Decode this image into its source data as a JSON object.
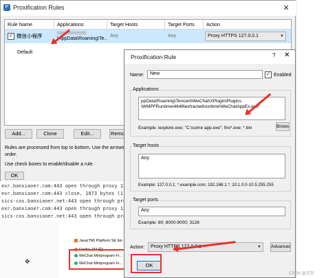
{
  "rules_window": {
    "title": "Proxification Rules",
    "columns": [
      "Rule Name",
      "Applications",
      "Target Hosts",
      "Target Ports",
      "Action"
    ],
    "rows": [
      {
        "name": "微信小程序",
        "app_prefix": "\\AppData\\Roaming\\Te...",
        "hosts": "Any",
        "ports": "Any",
        "action": "Proxy HTTPS 127.0.0.1"
      },
      {
        "name": "Default",
        "app": "",
        "hosts": "",
        "ports": "",
        "action": ""
      }
    ],
    "buttons": {
      "add": "Add...",
      "clone": "Clone",
      "edit": "Edit...",
      "remove": "Remo"
    },
    "help_line1": "Rules are processed from top to bottom. Use the arrows at the",
    "help_line1b": "order.",
    "help_line2": "Use check boxes to enable/disable a rule.",
    "ok": "OK"
  },
  "log": {
    "lines": [
      "exr.banxiaoer.com:443 open through proxy 127.0",
      "exr.banxiaoer.com:443 close, 1873 bytes (1.82",
      "sics-cos.banxiaoer.net:443 open through proxy",
      "exr.banxiaoer.com:443 open through proxy 127.0",
      "sics-cos.banxiaoer.net:443 open through proxy"
    ]
  },
  "tree": {
    "items": [
      "Java(TM) Platform SE bin",
      "Firefox (32 位)",
      "WeChat Miniprogram Fr...",
      "WeChat Miniprogram Fr..."
    ]
  },
  "dialog": {
    "title": "Proxification Rule",
    "help": "?",
    "close": "✕",
    "name_label": "Name:",
    "name_value": "New",
    "enabled_label": "Enabled",
    "applications_label": "Applications",
    "applications_value": "ppData\\Roaming\\Tencent\\WeChat\\XPlugin\\Plugins\n\\WMPFRuntime\\4648\\extracted\\runtime\\WeChatAppEx.exe\"",
    "applications_example": "Example: iexplore.exe; \"C:\\some app.exe\"; fire*.exe; *.bin",
    "browse": "Browse...",
    "target_hosts_label": "Target hosts",
    "target_hosts_value": "Any",
    "target_hosts_example": "Example: 127.0.0.1; *.example.com; 192.168.1.*; 10.1.0.0-10.5.255.255",
    "target_ports_label": "Target ports",
    "target_ports_value": "Any",
    "target_ports_example": "Example: 80; 8000-9000; 3128",
    "action_label": "Action:",
    "action_value": "Proxy HTTPS 127.0.0.1",
    "advanced": "Advanced...",
    "ok": "OK"
  },
  "watermark": "CSDN @万万"
}
